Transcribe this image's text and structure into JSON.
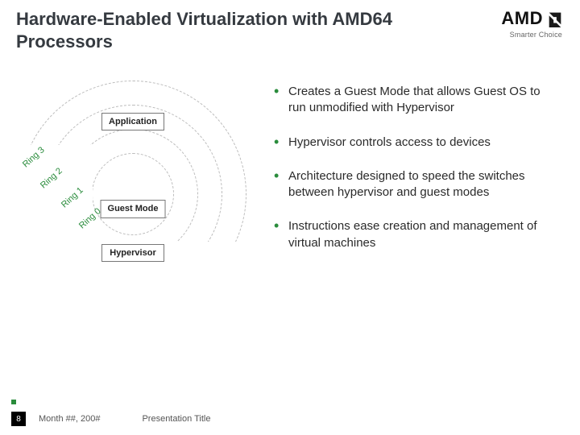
{
  "header": {
    "title": "Hardware-Enabled Virtualization with AMD64 Processors",
    "logo_text": "AMD",
    "logo_tagline": "Smarter Choice"
  },
  "diagram": {
    "ring_labels": [
      "Ring 3",
      "Ring 2",
      "Ring 1",
      "Ring 0"
    ],
    "box_application": "Application",
    "box_guest_mode": "Guest Mode",
    "box_hypervisor": "Hypervisor"
  },
  "bullets": [
    "Creates a Guest Mode that allows Guest OS to run unmodified with Hypervisor",
    "Hypervisor controls access to devices",
    "Architecture designed to speed the switches between hypervisor and guest modes",
    "Instructions ease creation and management of virtual machines"
  ],
  "footer": {
    "page_number": "8",
    "date_text": "Month ##, 200#",
    "presentation_title": "Presentation Title"
  }
}
